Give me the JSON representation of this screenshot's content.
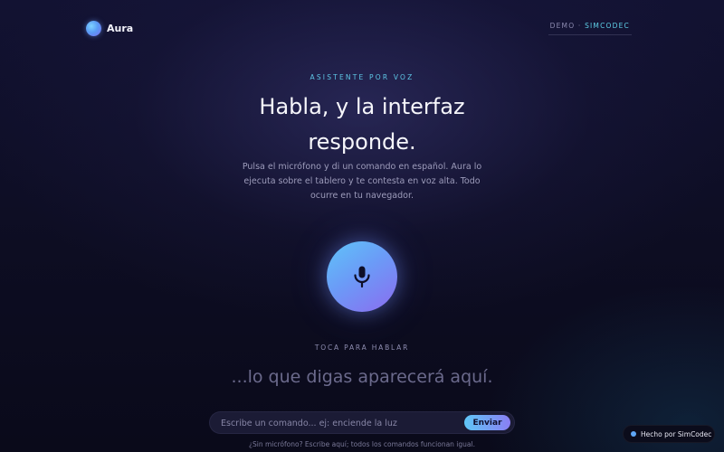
{
  "header": {
    "brand_name": "Aura",
    "demo_label": "DEMO · ",
    "demo_brand": "SIMCODEC"
  },
  "hero": {
    "eyebrow": "ASISTENTE POR VOZ",
    "headline_line1": "Habla, y la interfaz",
    "headline_line2": "responde.",
    "description": "Pulsa el micrófono y di un comando en español. Aura lo ejecuta sobre el tablero y te contesta en voz alta. Todo ocurre en tu navegador."
  },
  "mic": {
    "icon": "microphone-icon",
    "hint": "TOCA PARA HABLAR",
    "transcript_placeholder": "...lo que digas aparecerá aquí."
  },
  "command": {
    "placeholder": "Escribe un comando... ej: enciende la luz",
    "value": "",
    "send_label": "Enviar",
    "fallback_note": "¿Sin micrófono? Escribe aquí; todos los comandos funcionan igual."
  },
  "footer_badge": {
    "label": "Hecho por SimCodec"
  },
  "colors": {
    "accent_cyan": "#5fc6f6",
    "accent_violet": "#8a7ef3",
    "background": "#0d0d22"
  }
}
